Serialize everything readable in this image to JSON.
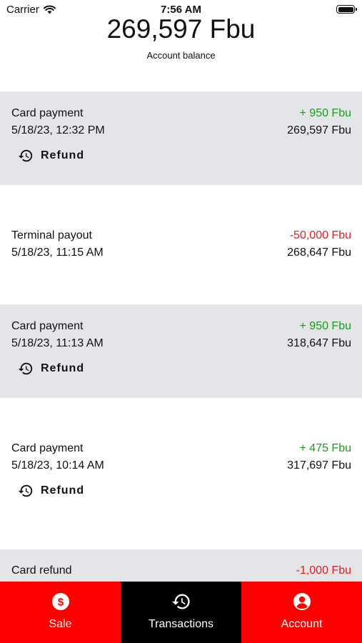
{
  "status": {
    "carrier": "Carrier",
    "time": "7:56 AM"
  },
  "header": {
    "balance": "269,597 Fbu",
    "balance_label": "Account balance"
  },
  "transactions": [
    {
      "title": "Card payment",
      "date": "5/18/23, 12:32 PM",
      "amount": "+ 950 Fbu",
      "running_balance": "269,597 Fbu",
      "refund_label": "Refund"
    },
    {
      "title": "Terminal payout",
      "date": "5/18/23, 11:15 AM",
      "amount": "-50,000 Fbu",
      "running_balance": "268,647 Fbu"
    },
    {
      "title": "Card payment",
      "date": "5/18/23, 11:13 AM",
      "amount": "+ 950 Fbu",
      "running_balance": "318,647 Fbu",
      "refund_label": "Refund"
    },
    {
      "title": "Card payment",
      "date": "5/18/23, 10:14 AM",
      "amount": "+ 475 Fbu",
      "running_balance": "317,697 Fbu",
      "refund_label": "Refund"
    },
    {
      "title": "Card refund",
      "amount": "-1,000 Fbu"
    }
  ],
  "tabs": [
    {
      "label": "Sale",
      "icon": "dollar-circle-icon"
    },
    {
      "label": "Transactions",
      "icon": "history-icon"
    },
    {
      "label": "Account",
      "icon": "account-circle-icon"
    }
  ],
  "colors": {
    "positive": "#1a9c1a",
    "negative": "#e02020",
    "tab_red": "#ff0000",
    "tab_active": "#000000",
    "row_gray": "#e4e5e9"
  }
}
